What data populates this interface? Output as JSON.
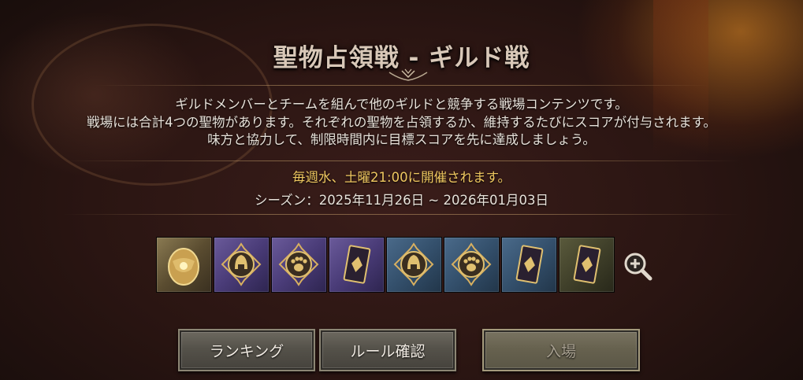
{
  "title": "聖物占領戦 - ギルド戦",
  "description": [
    "ギルドメンバーとチームを組んで他のギルドと競争する戦場コンテンツです。",
    "戦場には合計4つの聖物があります。それぞれの聖物を占領するか、維持するたびにスコアが付与されます。",
    "味方と協力して、制限時間内に目標スコアを先に達成しましょう。"
  ],
  "schedule": "毎週水、土曜21:00に開催されます。",
  "season": "シーズン：2025年11月26日 ~ 2026年01月03日",
  "rewards": [
    {
      "icon": "golden-egg-icon",
      "frame": "gold"
    },
    {
      "icon": "helmet-emblem-icon",
      "frame": "purple"
    },
    {
      "icon": "paw-emblem-icon",
      "frame": "purple"
    },
    {
      "icon": "card-emblem-icon",
      "frame": "purple"
    },
    {
      "icon": "helmet-emblem-icon",
      "frame": "blue"
    },
    {
      "icon": "paw-emblem-icon",
      "frame": "blue"
    },
    {
      "icon": "card-emblem-icon",
      "frame": "blue"
    },
    {
      "icon": "card-emblem-icon",
      "frame": "olive"
    }
  ],
  "zoom_icon": "zoom-in-icon",
  "buttons": {
    "ranking": "ランキング",
    "rules": "ルール確認",
    "enter": "入場"
  },
  "colors": {
    "schedule_text": "#f0c860",
    "title_text": "#d8c8b8"
  }
}
